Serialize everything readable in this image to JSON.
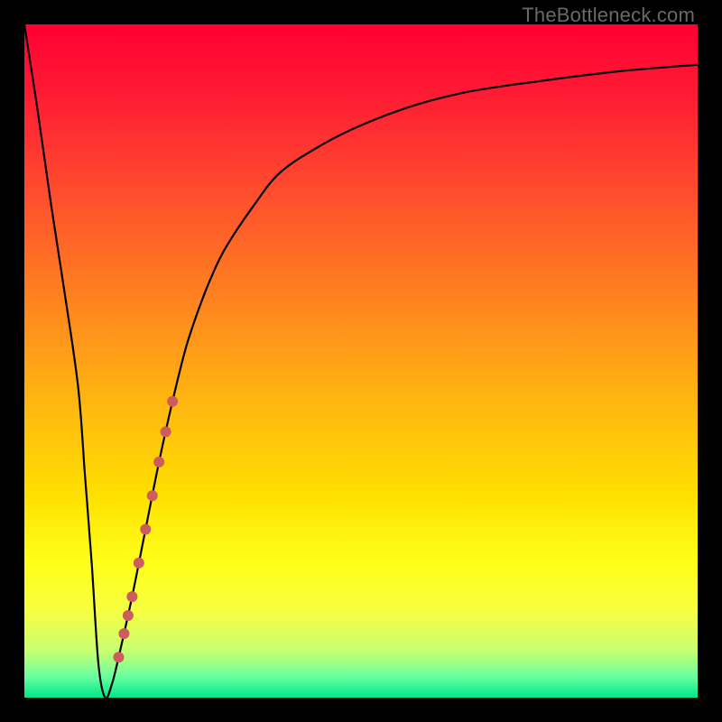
{
  "watermark": "TheBottleneck.com",
  "colors": {
    "frame": "#000000",
    "curve": "#000000",
    "marker": "#cd5c5c",
    "gradient_stops": [
      {
        "offset": 0.0,
        "color": "#ff0033"
      },
      {
        "offset": 0.1,
        "color": "#ff1a33"
      },
      {
        "offset": 0.25,
        "color": "#ff4d2e"
      },
      {
        "offset": 0.4,
        "color": "#ff8020"
      },
      {
        "offset": 0.55,
        "color": "#ffb312"
      },
      {
        "offset": 0.7,
        "color": "#ffe000"
      },
      {
        "offset": 0.8,
        "color": "#ffff1a"
      },
      {
        "offset": 0.87,
        "color": "#f7ff40"
      },
      {
        "offset": 0.93,
        "color": "#c8ff70"
      },
      {
        "offset": 0.97,
        "color": "#66ffa0"
      },
      {
        "offset": 1.0,
        "color": "#00e68a"
      }
    ]
  },
  "chart_data": {
    "type": "line",
    "title": "",
    "xlabel": "",
    "ylabel": "",
    "xlim": [
      0,
      100
    ],
    "ylim": [
      0,
      100
    ],
    "series": [
      {
        "name": "bottleneck-curve",
        "x": [
          0,
          2,
          4,
          6,
          8,
          9,
          10,
          11,
          12,
          13,
          14,
          16,
          18,
          20,
          22,
          24,
          26,
          28,
          30,
          34,
          38,
          44,
          50,
          58,
          66,
          76,
          88,
          100
        ],
        "y": [
          100,
          87,
          73,
          60,
          46,
          33,
          20,
          5,
          0,
          2,
          6,
          15,
          25,
          35,
          44,
          52,
          58,
          63,
          67,
          73,
          78,
          82,
          85,
          88,
          90,
          91.5,
          93,
          94
        ]
      }
    ],
    "markers": {
      "name": "highlight-segment",
      "points": [
        {
          "x": 14.0,
          "y": 6.0
        },
        {
          "x": 14.8,
          "y": 9.5
        },
        {
          "x": 15.4,
          "y": 12.2
        },
        {
          "x": 16.0,
          "y": 15.0
        },
        {
          "x": 17.0,
          "y": 20.0
        },
        {
          "x": 18.0,
          "y": 25.0
        },
        {
          "x": 19.0,
          "y": 30.0
        },
        {
          "x": 20.0,
          "y": 35.0
        },
        {
          "x": 21.0,
          "y": 39.5
        },
        {
          "x": 22.0,
          "y": 44.0
        }
      ],
      "radius": 6
    }
  }
}
